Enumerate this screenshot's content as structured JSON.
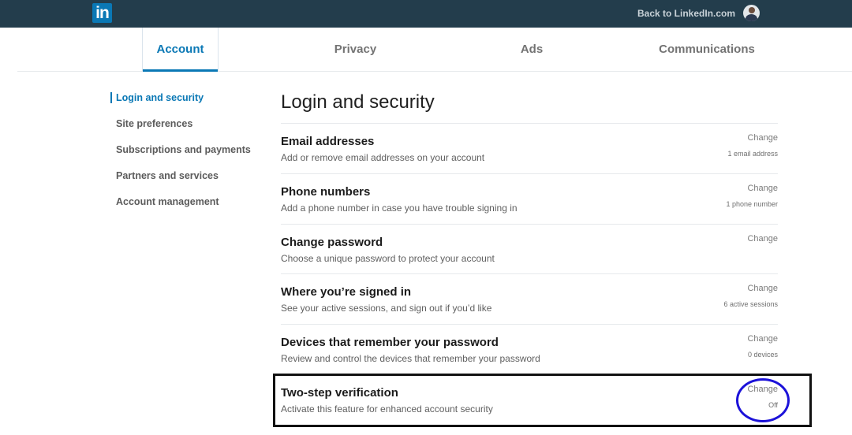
{
  "header": {
    "logo": "in",
    "back_link": "Back to LinkedIn.com"
  },
  "tabs": [
    {
      "label": "Account",
      "active": true
    },
    {
      "label": "Privacy",
      "active": false
    },
    {
      "label": "Ads",
      "active": false
    },
    {
      "label": "Communications",
      "active": false
    }
  ],
  "sidebar": {
    "items": [
      {
        "label": "Login and security",
        "active": true
      },
      {
        "label": "Site preferences",
        "active": false
      },
      {
        "label": "Subscriptions and payments",
        "active": false
      },
      {
        "label": "Partners and services",
        "active": false
      },
      {
        "label": "Account management",
        "active": false
      }
    ]
  },
  "main": {
    "title": "Login and security",
    "rows": [
      {
        "title": "Email addresses",
        "description": "Add or remove email addresses on your account",
        "action": "Change",
        "status": "1 email address"
      },
      {
        "title": "Phone numbers",
        "description": "Add a phone number in case you have trouble signing in",
        "action": "Change",
        "status": "1 phone number"
      },
      {
        "title": "Change password",
        "description": "Choose a unique password to protect your account",
        "action": "Change",
        "status": ""
      },
      {
        "title": "Where you’re signed in",
        "description": "See your active sessions, and sign out if you’d like",
        "action": "Change",
        "status": "6 active sessions"
      },
      {
        "title": "Devices that remember your password",
        "description": "Review and control the devices that remember your password",
        "action": "Change",
        "status": "0 devices"
      },
      {
        "title": "Two-step verification",
        "description": "Activate this feature for enhanced account security",
        "action": "Change",
        "status": "Off"
      }
    ]
  },
  "annotations": {
    "box_color": "#111111",
    "circle_color": "#1c12d9"
  }
}
